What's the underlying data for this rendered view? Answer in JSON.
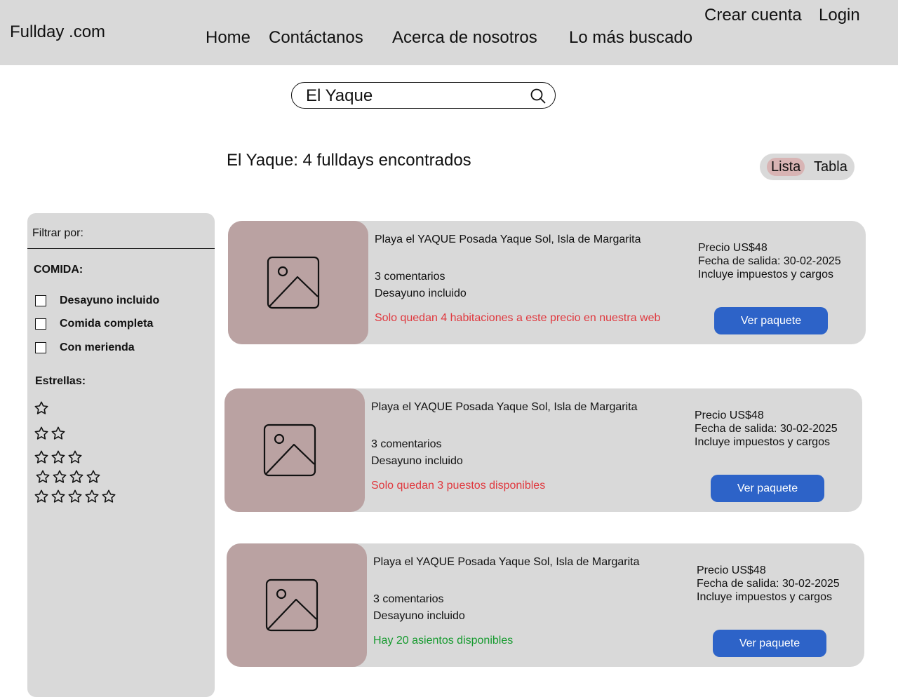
{
  "header": {
    "logo": "Fullday .com",
    "create_account": "Crear cuenta",
    "login": "Login",
    "nav": [
      "Home",
      "Contáctanos",
      "Acerca de nosotros",
      "Lo más buscado"
    ]
  },
  "search": {
    "value": "El Yaque",
    "icon": "search-icon"
  },
  "results": {
    "title": "El Yaque: 4 fulldays encontrados"
  },
  "view_toggle": {
    "lista": "Lista",
    "tabla": "Tabla",
    "selected": "Lista"
  },
  "sidebar": {
    "filter_title": "Filtrar por:",
    "comida_label": "COMIDA:",
    "comida_options": [
      "Desayuno incluido",
      "Comida completa",
      "Con merienda"
    ],
    "estrellas_label": "Estrellas:",
    "star_levels": [
      1,
      2,
      3,
      4,
      5
    ]
  },
  "cards": [
    {
      "title": "Playa el YAQUE Posada Yaque Sol, Isla de Margarita",
      "comments": "3 comentarios",
      "meal": "Desayuno incluido",
      "notice": "Solo quedan 4 habitaciones a este precio en nuestra web",
      "notice_color": "#e0383e",
      "price": "Precio US$48",
      "departure": "Fecha de salida: 30-02-2025",
      "taxes": "Incluye impuestos y cargos",
      "button": "Ver paquete"
    },
    {
      "title": "Playa el YAQUE Posada Yaque Sol, Isla de Margarita",
      "comments": "3 comentarios",
      "meal": "Desayuno incluido",
      "notice": "Solo quedan 3 puestos disponibles",
      "notice_color": "#e0383e",
      "price": "Precio US$48",
      "departure": "Fecha de salida: 30-02-2025",
      "taxes": "Incluye impuestos y cargos",
      "button": "Ver paquete"
    },
    {
      "title": "Playa el YAQUE Posada Yaque Sol, Isla de Margarita",
      "comments": "3 comentarios",
      "meal": "Desayuno incluido",
      "notice": "Hay 20 asientos disponibles",
      "notice_color": "#159a2e",
      "price": "Precio US$48",
      "departure": "Fecha de salida: 30-02-2025",
      "taxes": "Incluye impuestos y cargos",
      "button": "Ver paquete"
    }
  ],
  "colors": {
    "header_bg": "#d9d9d9",
    "thumb_bg": "#baa2a2",
    "button_bg": "#2d63c8",
    "toggle_selected_bg": "#d8b4b4"
  }
}
